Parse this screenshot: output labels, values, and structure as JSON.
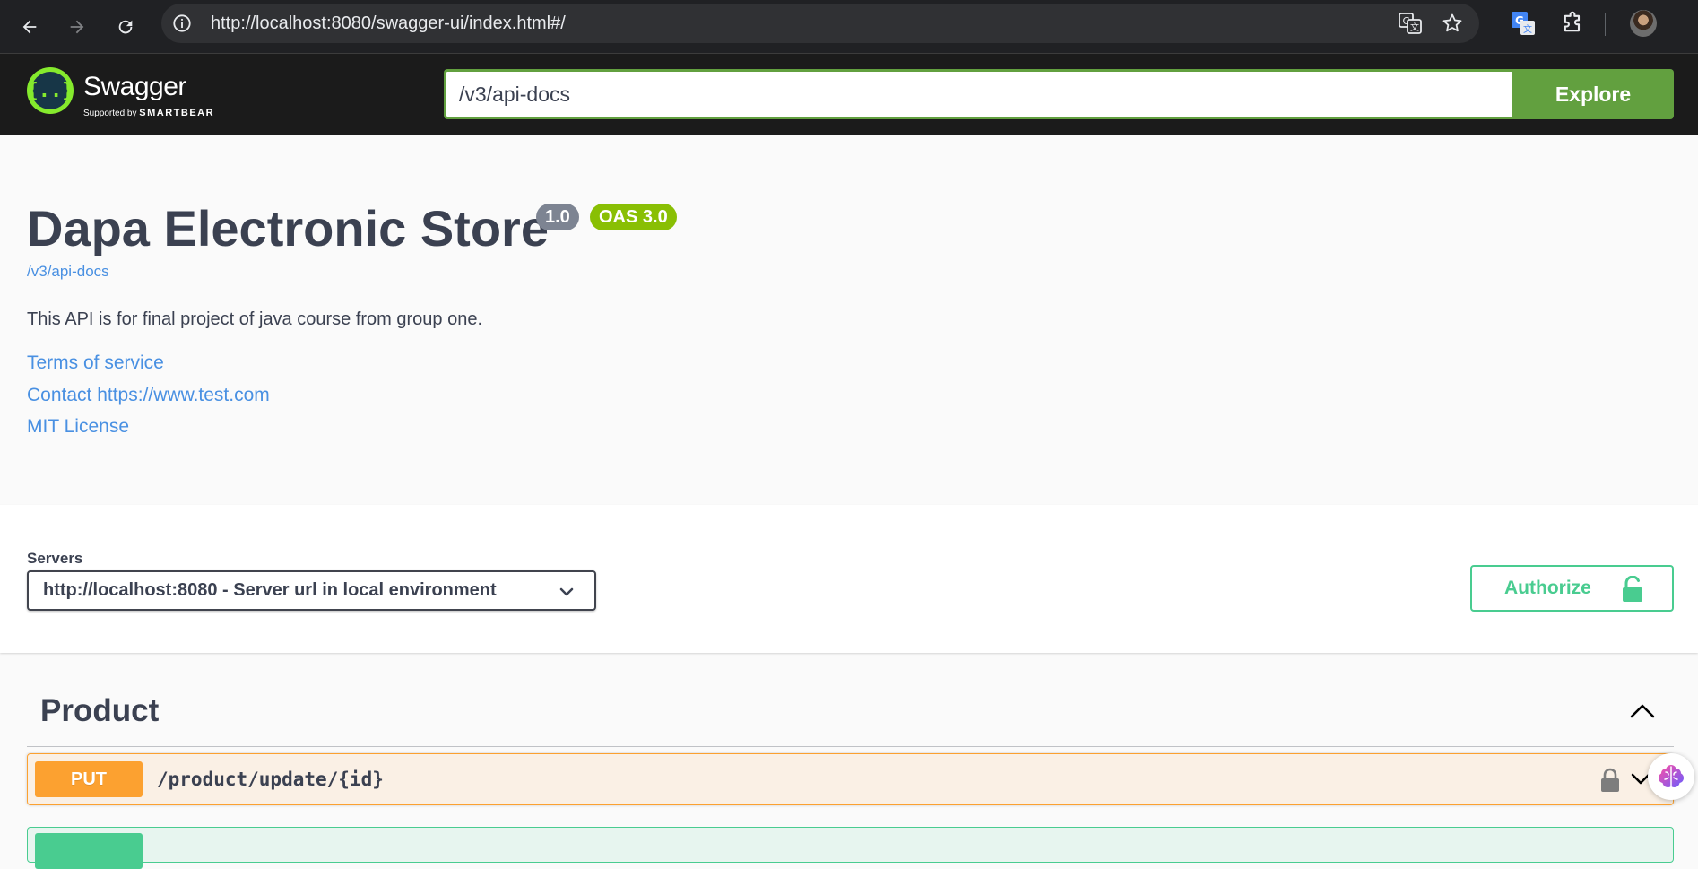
{
  "browser": {
    "url": "http://localhost:8080/swagger-ui/index.html#/"
  },
  "topbar": {
    "logo_text": "Swagger",
    "logo_sub_prefix": "Supported by",
    "logo_sub_brand": "SMARTBEAR",
    "spec_url_value": "/v3/api-docs",
    "explore_label": "Explore"
  },
  "info": {
    "title": "Dapa Electronic Store",
    "version": "1.0",
    "oas": "OAS 3.0",
    "spec_link": "/v3/api-docs",
    "description": "This API is for final project of java course from group one.",
    "links": [
      "Terms of service",
      "Contact https://www.test.com",
      "MIT License"
    ]
  },
  "servers": {
    "label": "Servers",
    "selected": "http://localhost:8080 - Server url in local environment"
  },
  "authorize": {
    "label": "Authorize"
  },
  "operations": {
    "tag": "Product",
    "items": [
      {
        "method": "PUT",
        "path": "/product/update/{id}"
      }
    ]
  },
  "colors": {
    "swagger_green": "#62a03f",
    "link_blue": "#4990e2",
    "put_orange": "#fca130",
    "post_green": "#49cc90",
    "version_badge": "#7d8492",
    "oas_badge": "#89bf04"
  },
  "icons": [
    "back-arrow-icon",
    "forward-arrow-icon",
    "reload-icon",
    "site-info-icon",
    "translate-icon",
    "bookmark-star-icon",
    "google-translate-extension-icon",
    "extensions-puzzle-icon",
    "swagger-logo-icon",
    "chevron-down-icon",
    "unlock-icon",
    "chevron-up-icon",
    "lock-icon",
    "brain-extension-icon"
  ]
}
